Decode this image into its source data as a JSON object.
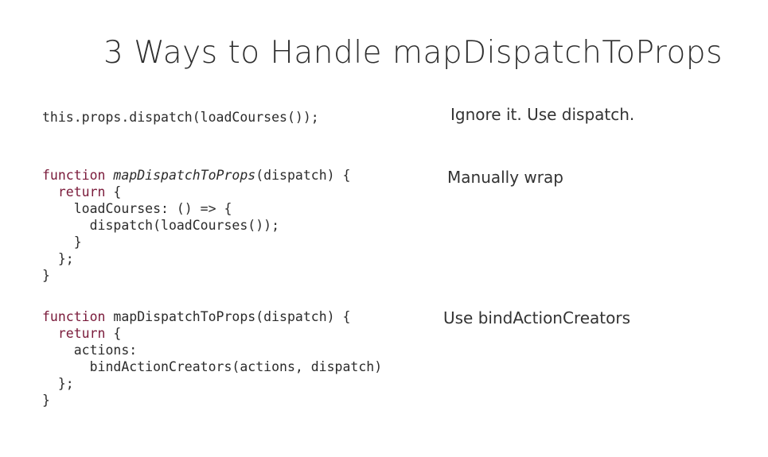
{
  "slide": {
    "title": "3 Ways to Handle mapDispatchToProps"
  },
  "section1": {
    "code": "this.props.dispatch(loadCourses());",
    "label": "Ignore it. Use dispatch."
  },
  "section2": {
    "kw_function": "function",
    "fn_name": "mapDispatchToProps",
    "signature_rest": "(dispatch) {",
    "indent_return": "  ",
    "kw_return": "return",
    "return_rest": " {",
    "body": "    loadCourses: () => {\n      dispatch(loadCourses());\n    }\n  };\n}",
    "label": "Manually wrap"
  },
  "section3": {
    "kw_function": "function",
    "fn_signature": " mapDispatchToProps(dispatch) {",
    "indent_return": "  ",
    "kw_return": "return",
    "return_rest": " {",
    "body": "    actions:\n      bindActionCreators(actions, dispatch)\n  };\n}",
    "label": "Use bindActionCreators"
  }
}
